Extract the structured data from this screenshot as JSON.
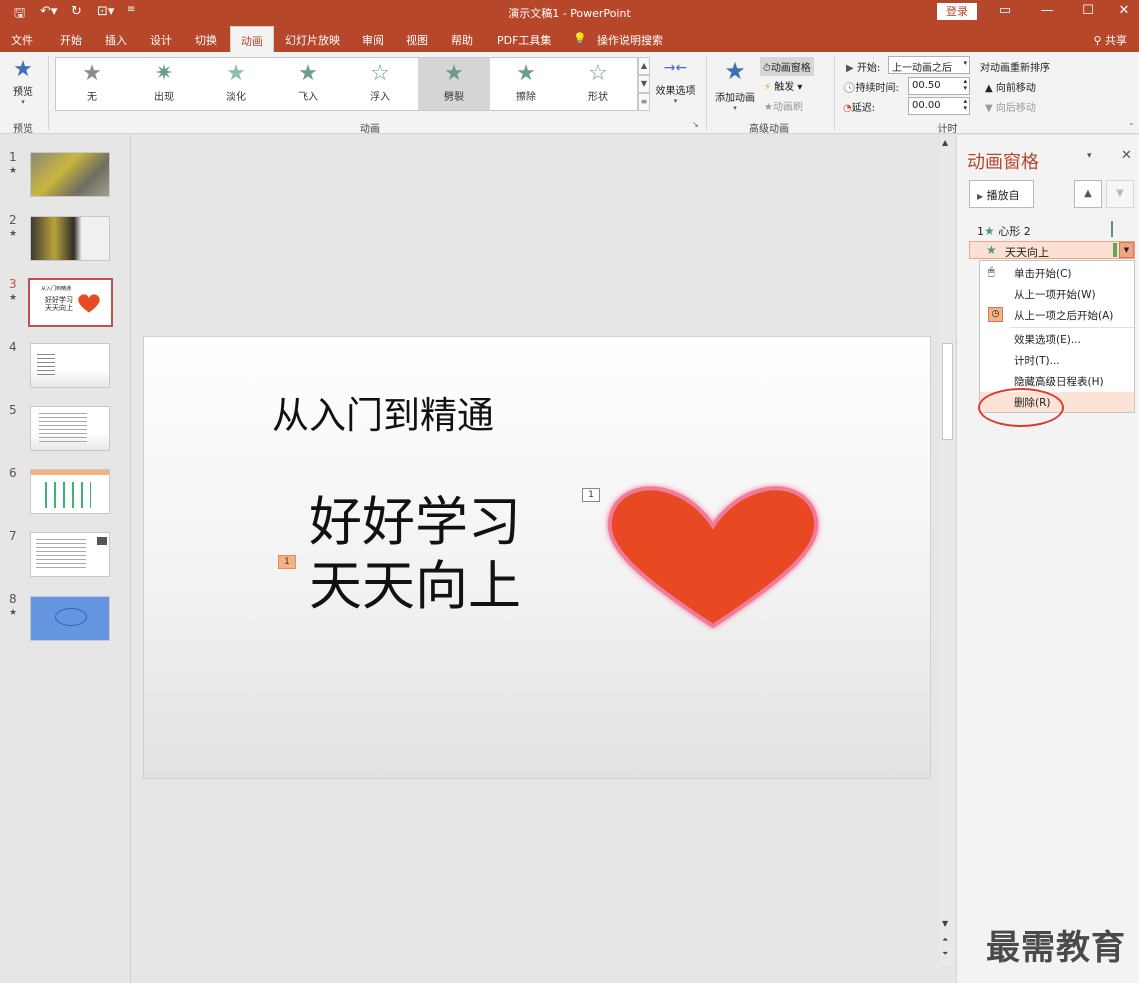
{
  "app": {
    "title": "演示文稿1 - PowerPoint",
    "login": "登录",
    "share": "共享"
  },
  "tabs": [
    "文件",
    "开始",
    "插入",
    "设计",
    "切换",
    "动画",
    "幻灯片放映",
    "审阅",
    "视图",
    "帮助",
    "PDF工具集",
    "操作说明搜索"
  ],
  "ribbon": {
    "preview_label": "预览",
    "preview_group": "预览",
    "animations_group": "动画",
    "gallery": [
      "无",
      "出现",
      "淡化",
      "飞入",
      "浮入",
      "劈裂",
      "擦除",
      "形状"
    ],
    "gallery_selected": "劈裂",
    "effect_options": "效果选项",
    "add_animation": "添加动画",
    "animation_pane": "动画窗格",
    "trigger": "触发",
    "animation_painter": "动画刷",
    "advanced_group": "高级动画",
    "start_label": "开始:",
    "start_value": "上一动画之后",
    "duration_label": "持续时间:",
    "duration_value": "00.50",
    "delay_label": "延迟:",
    "delay_value": "00.00",
    "reorder_title": "对动画重新排序",
    "move_earlier": "向前移动",
    "move_later": "向后移动",
    "timing_group": "计时"
  },
  "thumbnails": [
    {
      "num": "1",
      "star": "★"
    },
    {
      "num": "2",
      "star": "★"
    },
    {
      "num": "3",
      "star": "★"
    },
    {
      "num": "4",
      "star": ""
    },
    {
      "num": "5",
      "star": ""
    },
    {
      "num": "6",
      "star": ""
    },
    {
      "num": "7",
      "star": ""
    },
    {
      "num": "8",
      "star": "★"
    }
  ],
  "thumb3": {
    "title": "从入门到精通",
    "line1": "好好学习",
    "line2": "天天向上"
  },
  "slide": {
    "title": "从入门到精通",
    "line1": "好好学习",
    "line2": "天天向上",
    "tag_text": "1",
    "tag_heart": "1"
  },
  "pane": {
    "title": "动画窗格",
    "play_from": "播放自",
    "items": [
      {
        "num": "1",
        "name": "心形 2"
      },
      {
        "num": "",
        "name": "天天向上"
      }
    ],
    "menu": [
      "单击开始(C)",
      "从上一项开始(W)",
      "从上一项之后开始(A)",
      "效果选项(E)...",
      "计时(T)...",
      "隐藏高级日程表(H)",
      "删除(R)"
    ]
  },
  "watermark": "最需教育",
  "colors": {
    "accent": "#b7472a",
    "heart": "#e84a23",
    "highlight": "#fbe0d3"
  }
}
